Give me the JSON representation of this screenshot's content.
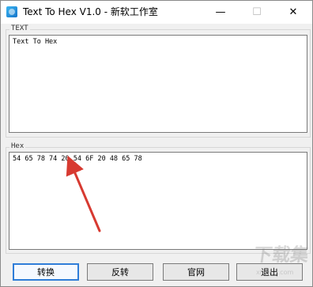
{
  "window": {
    "title": "Text To Hex V1.0 - 新软工作室",
    "controls": {
      "minimize": "—",
      "maximize": "☐",
      "close": "✕"
    }
  },
  "sections": {
    "text": {
      "label": "TEXT",
      "value": "Text To Hex"
    },
    "hex": {
      "label": "Hex",
      "value": "54 65 78 74 20 54 6F 20 48 65 78"
    }
  },
  "buttons": {
    "convert": "转换",
    "reverse": "反转",
    "official_site": "官网",
    "exit": "退出"
  },
  "annotation": {
    "arrow_color": "#d73a31"
  },
  "watermark": {
    "main": "下载集",
    "sub": "xiazaiji.com"
  }
}
